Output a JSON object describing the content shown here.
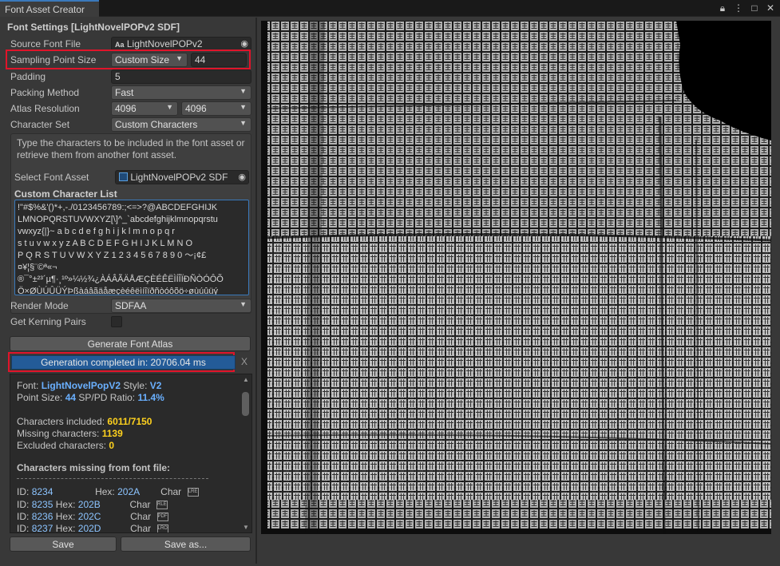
{
  "window": {
    "tab_title": "Font Asset Creator",
    "icons": [
      "lock-icon",
      "kebab-menu-icon",
      "maximize-icon",
      "close-icon"
    ]
  },
  "settings": {
    "header": "Font Settings [LightNovelPOPv2 SDF]",
    "source_font_file": {
      "label": "Source Font File",
      "value": "LightNovelPOPv2",
      "prefix": "Aa"
    },
    "sampling_point_size": {
      "label": "Sampling Point Size",
      "mode": "Custom Size",
      "value": "44"
    },
    "padding": {
      "label": "Padding",
      "value": "5"
    },
    "packing_method": {
      "label": "Packing Method",
      "value": "Fast"
    },
    "atlas_resolution": {
      "label": "Atlas Resolution",
      "width": "4096",
      "height": "4096"
    },
    "character_set": {
      "label": "Character Set",
      "value": "Custom Characters"
    },
    "help_text": "Type the characters to be included in the font asset or retrieve them from another font asset.",
    "select_font_asset": {
      "label": "Select Font Asset",
      "value": "LightNovelPOPv2 SDF"
    },
    "custom_char_list_title": "Custom Character List",
    "custom_char_lines": [
      "!\"#$%&'()*+,-./0123456789:;<=>?@ABCDEFGHIJK",
      "LMNOPQRSTUVWXYZ[\\]^_`abcdefghijklmnopqrstu",
      "vwxyz{|}~ a b c d e f g h i j k l m n o p q r",
      "s t u v w x y z A B C D E F G H I J K L M N O",
      "P Q R S T U V W X Y Z 1 2 3 4 5 6 7 8 9 0 〜¡¢£",
      "¤¥¦§¨©ª«¬",
      "®¯°±²³´µ¶·¸¹º»¼½¾¿ÀÁÂÃÄÅÆÇÈÉÊËÌÍÎÏÐÑÒÓÔÕ",
      "Ö×ØÙÚÛÜÝÞßàáâãäåæçèéêëìíîïðñòóôõö÷øùúûüý"
    ],
    "render_mode": {
      "label": "Render Mode",
      "value": "SDFAA"
    },
    "kerning": {
      "label": "Get Kerning Pairs"
    },
    "generate_button": "Generate Font Atlas"
  },
  "progress": {
    "text": "Generation completed in: 20706.04 ms",
    "close": "X"
  },
  "report": {
    "font_label": "Font:",
    "font_value": "LightNovelPopV2",
    "style_label": "Style:",
    "style_value": "V2",
    "point_size_label": "Point Size:",
    "point_size_value": "44",
    "ratio_label": "SP/PD Ratio:",
    "ratio_value": "11.4%",
    "included_label": "Characters included:",
    "included_value": "6011/7150",
    "missing_label": "Missing characters:",
    "missing_value": "1139",
    "excluded_label": "Excluded characters:",
    "excluded_value": "0",
    "missing_header": "Characters missing from font file:",
    "missing_rows": [
      {
        "id_label": "ID:",
        "id": "8234",
        "hex_label": "Hex:",
        "hex": "202A",
        "char_label": "Char",
        "glyph": "LRE"
      },
      {
        "id_label": "ID:",
        "id": "8235",
        "hex_label": "Hex:",
        "hex": "202B",
        "char_label": "Char",
        "glyph": "RLE"
      },
      {
        "id_label": "ID:",
        "id": "8236",
        "hex_label": "Hex:",
        "hex": "202C",
        "char_label": "Char",
        "glyph": "PDF"
      },
      {
        "id_label": "ID:",
        "id": "8237",
        "hex_label": "Hex:",
        "hex": "202D",
        "char_label": "Char",
        "glyph": "LRO"
      }
    ]
  },
  "footer": {
    "save": "Save",
    "save_as": "Save as..."
  }
}
